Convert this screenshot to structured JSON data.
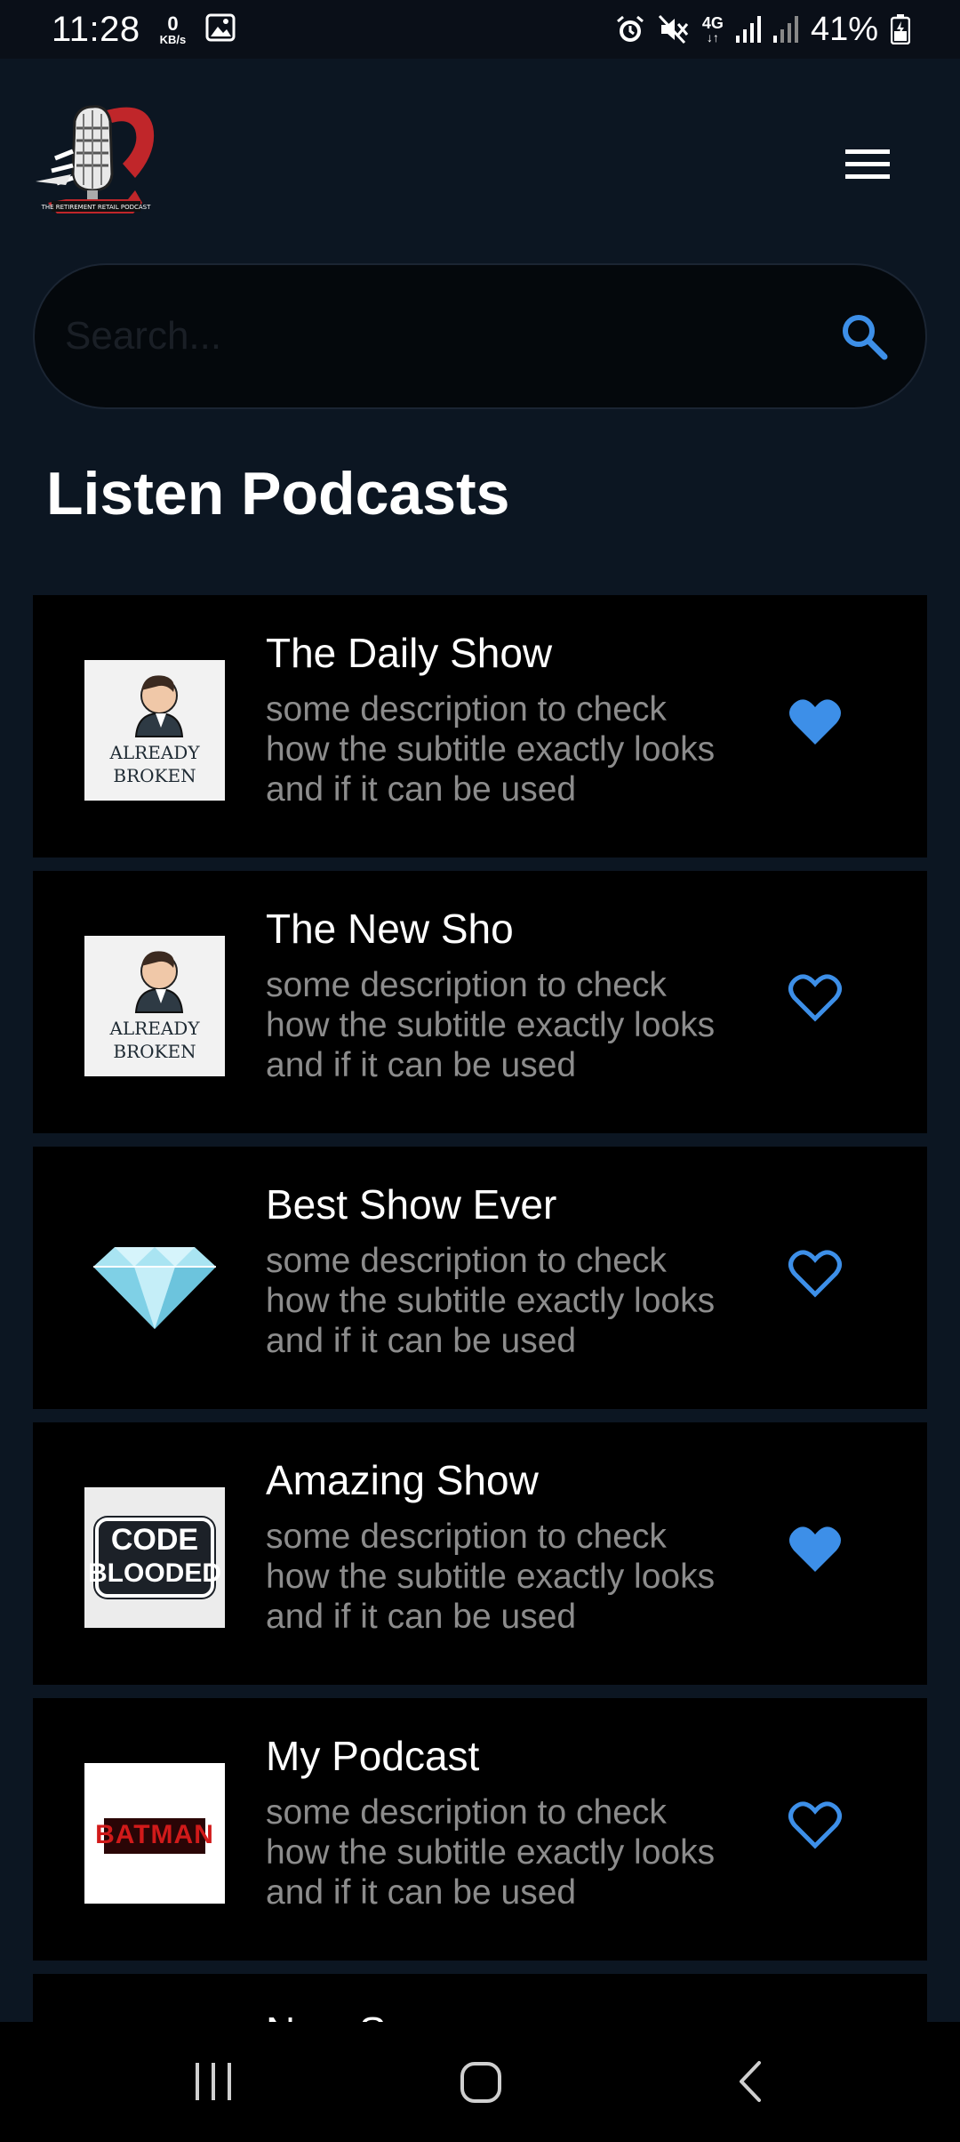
{
  "status_bar": {
    "time": "11:28",
    "net_speed_value": "0",
    "net_speed_unit": "KB/s",
    "network_type": "4G",
    "battery": "41%"
  },
  "header": {
    "logo_icon": "podcast-microphone-logo",
    "menu_icon": "hamburger-menu-icon"
  },
  "search": {
    "placeholder": "Search...",
    "value": "",
    "icon": "search-icon"
  },
  "section_title": "Listen Podcasts",
  "podcasts": [
    {
      "title": "The Daily Show",
      "description": "some description to check how the subtitle exactly looks and if it can be used",
      "favorite": true,
      "thumbnail": "already-broken-art",
      "thumb_text": [
        "ALREADY",
        "BROKEN"
      ]
    },
    {
      "title": "The New Sho",
      "description": "some description to check how the subtitle exactly looks and if it can be used",
      "favorite": false,
      "thumbnail": "already-broken-art",
      "thumb_text": [
        "ALREADY",
        "BROKEN"
      ]
    },
    {
      "title": "Best Show Ever",
      "description": "some description to check how the subtitle exactly looks and if it can be used",
      "favorite": false,
      "thumbnail": "diamond-art"
    },
    {
      "title": "Amazing Show",
      "description": "some description to check how the subtitle exactly looks and if it can be used",
      "favorite": true,
      "thumbnail": "code-blooded-art",
      "thumb_text": [
        "CODE",
        "BLOODED"
      ]
    },
    {
      "title": "My Podcast",
      "description": "some description to check how the subtitle exactly looks and if it can be used",
      "favorite": false,
      "thumbnail": "batman-art",
      "thumb_text": [
        "BATMAN"
      ]
    },
    {
      "title": "New Sync",
      "description": "",
      "favorite": false,
      "thumbnail": ""
    }
  ],
  "colors": {
    "background": "#0c1622",
    "card": "#000000",
    "accent": "#3d8fe8",
    "subtitle": "#8c8c8c"
  },
  "nav_bar": {
    "recents_icon": "recents-icon",
    "home_icon": "home-icon",
    "back_icon": "back-icon"
  }
}
